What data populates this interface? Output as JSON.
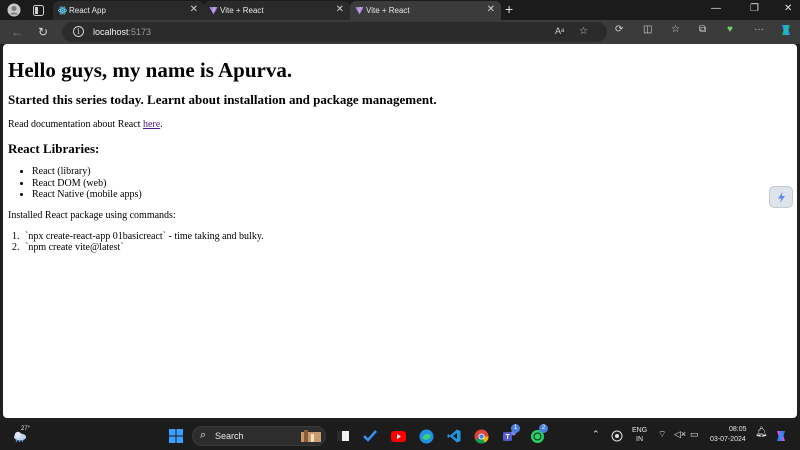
{
  "browser": {
    "tabs": [
      {
        "title": "React App",
        "favicon": "react-icon",
        "active": false
      },
      {
        "title": "Vite + React",
        "favicon": "vite-icon",
        "active": false
      },
      {
        "title": "Vite + React",
        "favicon": "vite-icon",
        "active": true
      }
    ],
    "address": {
      "host": "localhost",
      "port": ":5173"
    },
    "accent": "#3b3b3b"
  },
  "page": {
    "heading": "Hello guys, my name is Apurva.",
    "subheading": "Started this series today. Learnt about installation and package management.",
    "doc_prefix": "Read documentation about React ",
    "doc_link": "here",
    "doc_suffix": ".",
    "libraries_heading": "React Libraries:",
    "libraries": [
      "React (library)",
      "React DOM (web)",
      "React Native (mobile apps)"
    ],
    "installed_text": "Installed React package using commands:",
    "commands": [
      "`npx create-react-app 01basicreact` - time taking and bulky.",
      "`npm create vite@latest`"
    ],
    "link_color": "#551a8b"
  },
  "taskbar": {
    "weather_temp": "27°",
    "search_label": "Search",
    "teams_badge": "1",
    "whatsapp_badge": "2",
    "lang_top": "ENG",
    "lang_bottom": "IN",
    "time": "08:05",
    "date": "03-07-2024"
  }
}
